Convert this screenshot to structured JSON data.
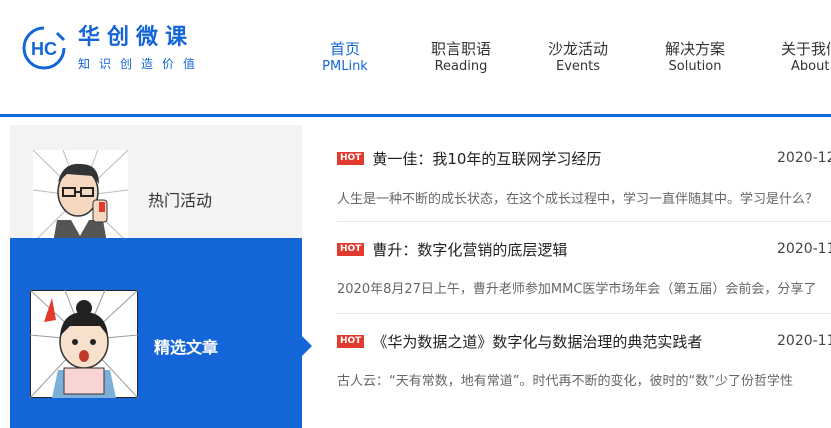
{
  "brand": {
    "name_cn": "华创微课",
    "slogan": "知识创造价值",
    "logo_letters": "HC",
    "accent_color": "#1466d8",
    "hot_color": "#e23a2f"
  },
  "nav": {
    "items": [
      {
        "cn": "首页",
        "en": "PMLink",
        "active": true
      },
      {
        "cn": "职言职语",
        "en": "Reading"
      },
      {
        "cn": "沙龙活动",
        "en": "Events"
      },
      {
        "cn": "解决方案",
        "en": "Solution"
      },
      {
        "cn": "关于我们",
        "en": "About"
      }
    ]
  },
  "sidebar": {
    "items": [
      {
        "label": "热门活动",
        "icon": "cartoon-man-glasses",
        "active": false
      },
      {
        "label": "精选文章",
        "icon": "cartoon-woman-reading",
        "active": true
      }
    ]
  },
  "articles": [
    {
      "badge": "HOT",
      "title": "黄一佳：我10年的互联网学习经历",
      "date": "2020-12",
      "summary": "人生是一种不断的成长状态，在这个成长过程中，学习一直伴随其中。学习是什么？"
    },
    {
      "badge": "HOT",
      "title": "曹升：数字化营销的底层逻辑",
      "date": "2020-11",
      "summary": "2020年8月27日上午，曹升老师参加MMC医学市场年会（第五届）会前会，分享了"
    },
    {
      "badge": "HOT",
      "title": "《华为数据之道》数字化与数据治理的典范实践者",
      "date": "2020-11",
      "summary": "古人云：“天有常数，地有常道”。时代再不断的变化，彼时的“数”少了份哲学性"
    }
  ]
}
